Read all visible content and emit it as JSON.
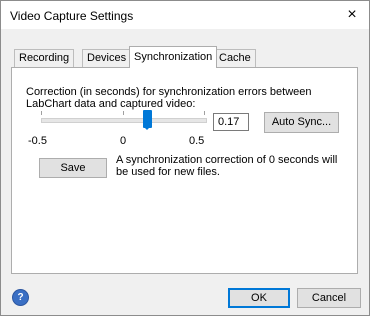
{
  "window": {
    "title": "Video Capture Settings",
    "close_glyph": "×"
  },
  "tabs": [
    {
      "label": "Recording",
      "selected": false
    },
    {
      "label": "Devices",
      "selected": false
    },
    {
      "label": "Synchronization",
      "selected": true
    },
    {
      "label": "Cache",
      "selected": false
    }
  ],
  "sync": {
    "description": "Correction (in seconds) for synchronization errors between LabChart data and captured video:",
    "slider": {
      "min": -0.5,
      "max": 0.5,
      "value": 0.17
    },
    "value_text": "0.17",
    "auto_sync_label": "Auto Sync...",
    "scale_labels": {
      "min": "-0.5",
      "mid": "0",
      "max": "0.5"
    },
    "save_label": "Save",
    "save_note": "A synchronization correction of 0 seconds will be used for new files."
  },
  "footer": {
    "help_icon": "help-icon",
    "help_glyph": "?",
    "ok_label": "OK",
    "cancel_label": "Cancel"
  },
  "colors": {
    "accent": "#0078d7"
  }
}
